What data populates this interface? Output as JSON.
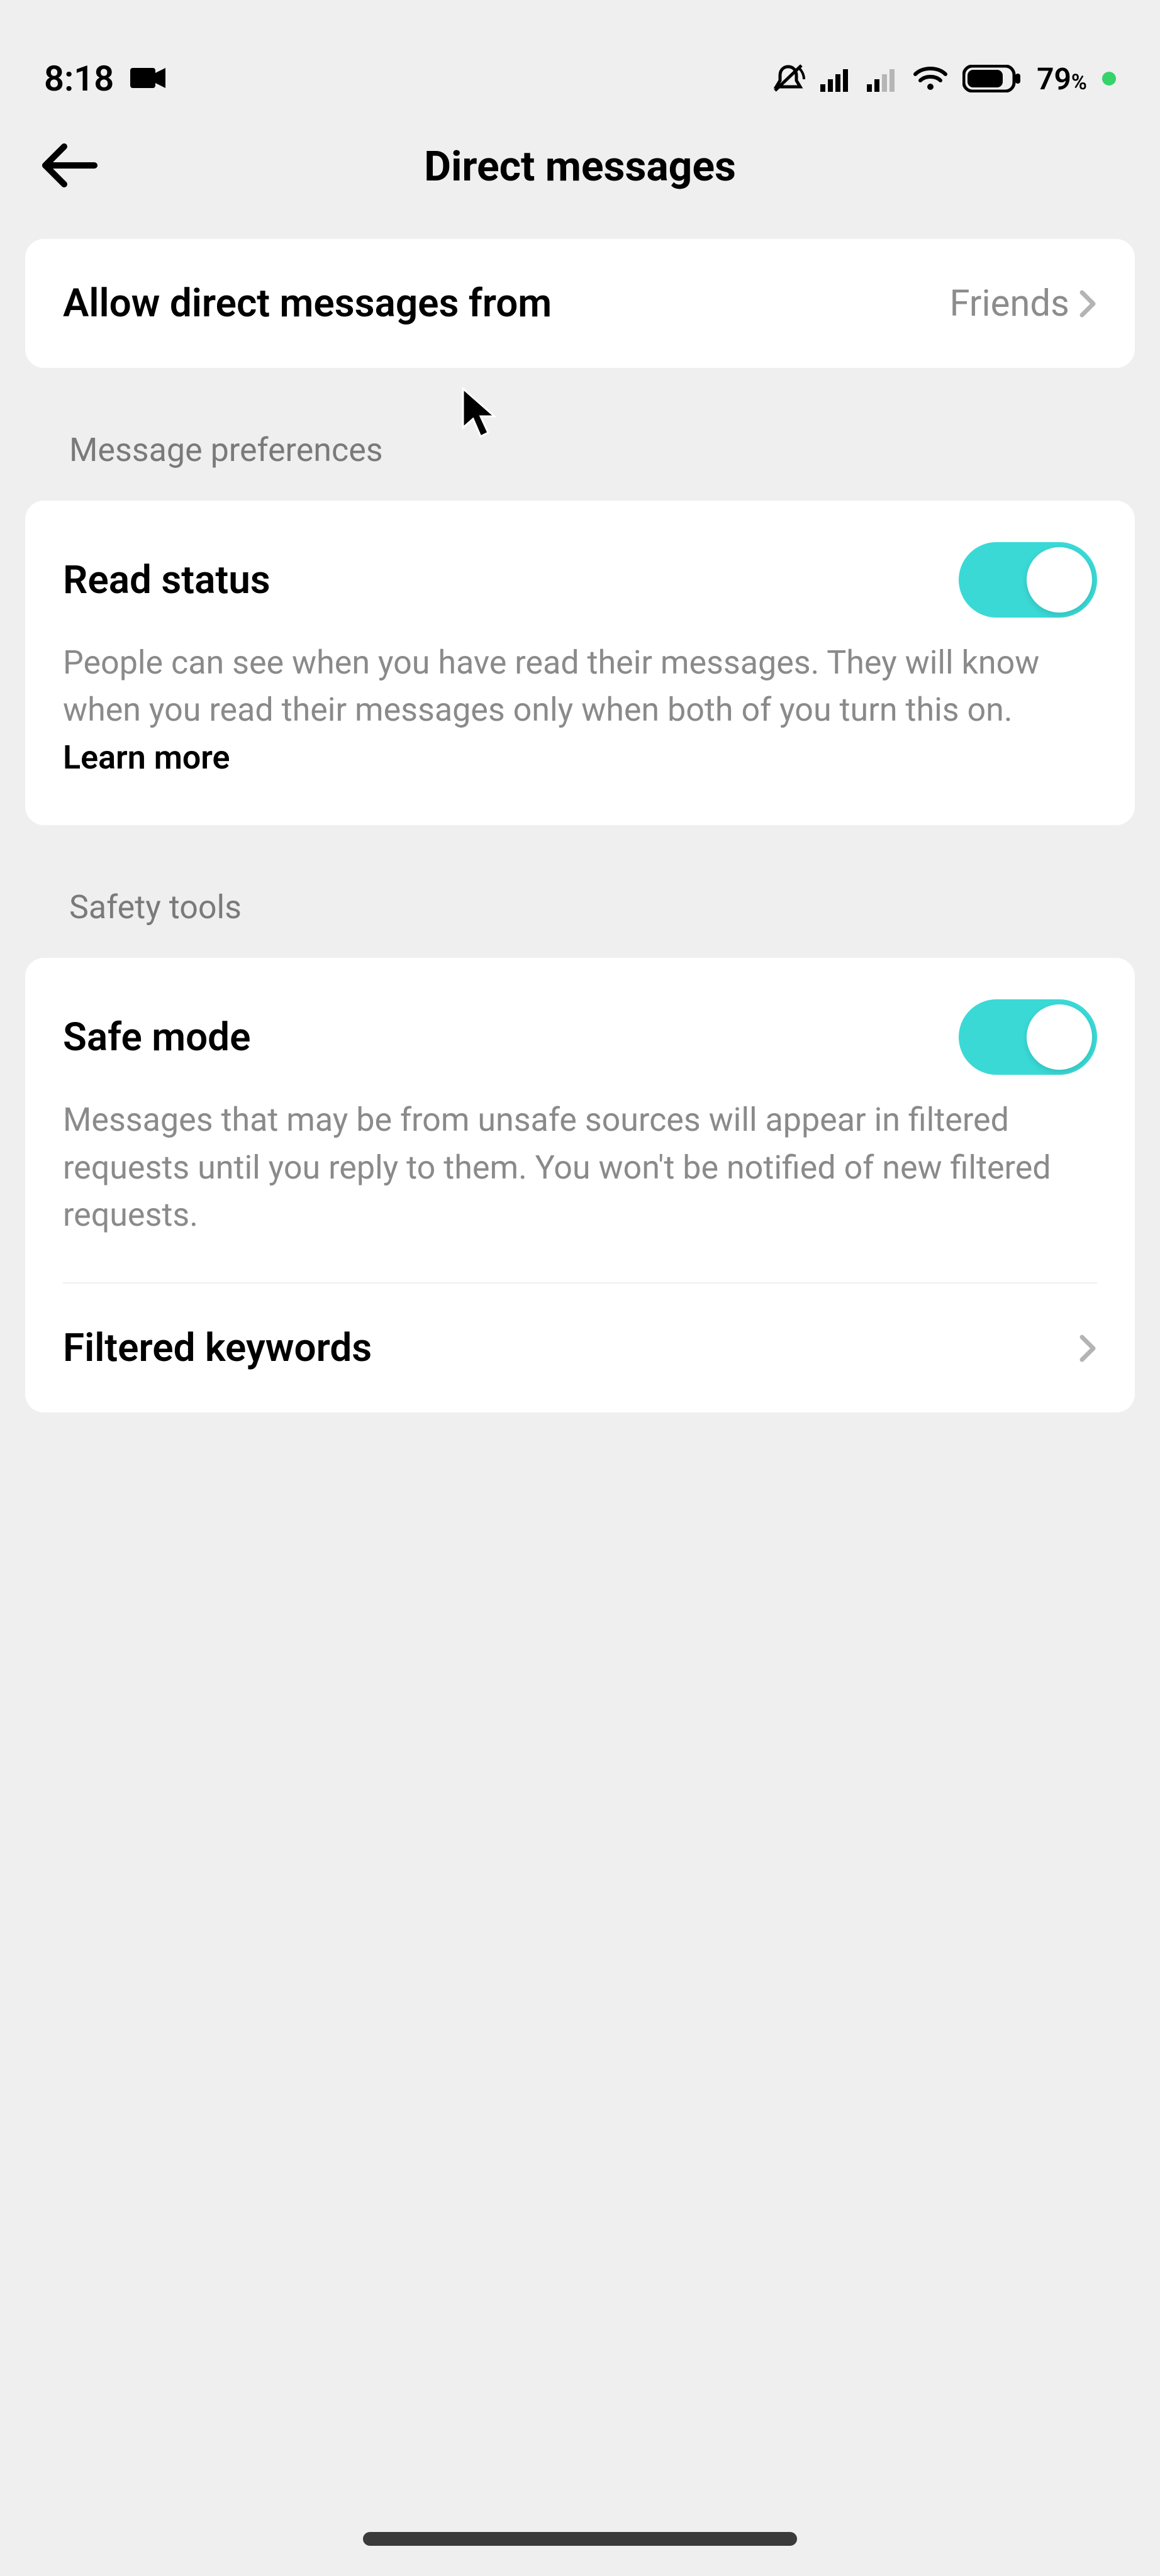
{
  "status_bar": {
    "time": "8:18",
    "battery_pct": "79",
    "battery_pct_suffix": "%"
  },
  "header": {
    "title": "Direct messages"
  },
  "allow_from": {
    "label": "Allow direct messages from",
    "value": "Friends"
  },
  "sections": {
    "message_prefs_label": "Message preferences",
    "safety_tools_label": "Safety tools"
  },
  "read_status": {
    "title": "Read status",
    "description": "People can see when you have read their messages. They will know when you read their messages only when both of you turn this on. ",
    "learn_more": "Learn more",
    "enabled": true
  },
  "safe_mode": {
    "title": "Safe mode",
    "description": "Messages that may be from unsafe sources will appear in filtered requests until you reply to them. You won't be notified of new filtered requests.",
    "enabled": true
  },
  "filtered_keywords": {
    "title": "Filtered keywords"
  }
}
